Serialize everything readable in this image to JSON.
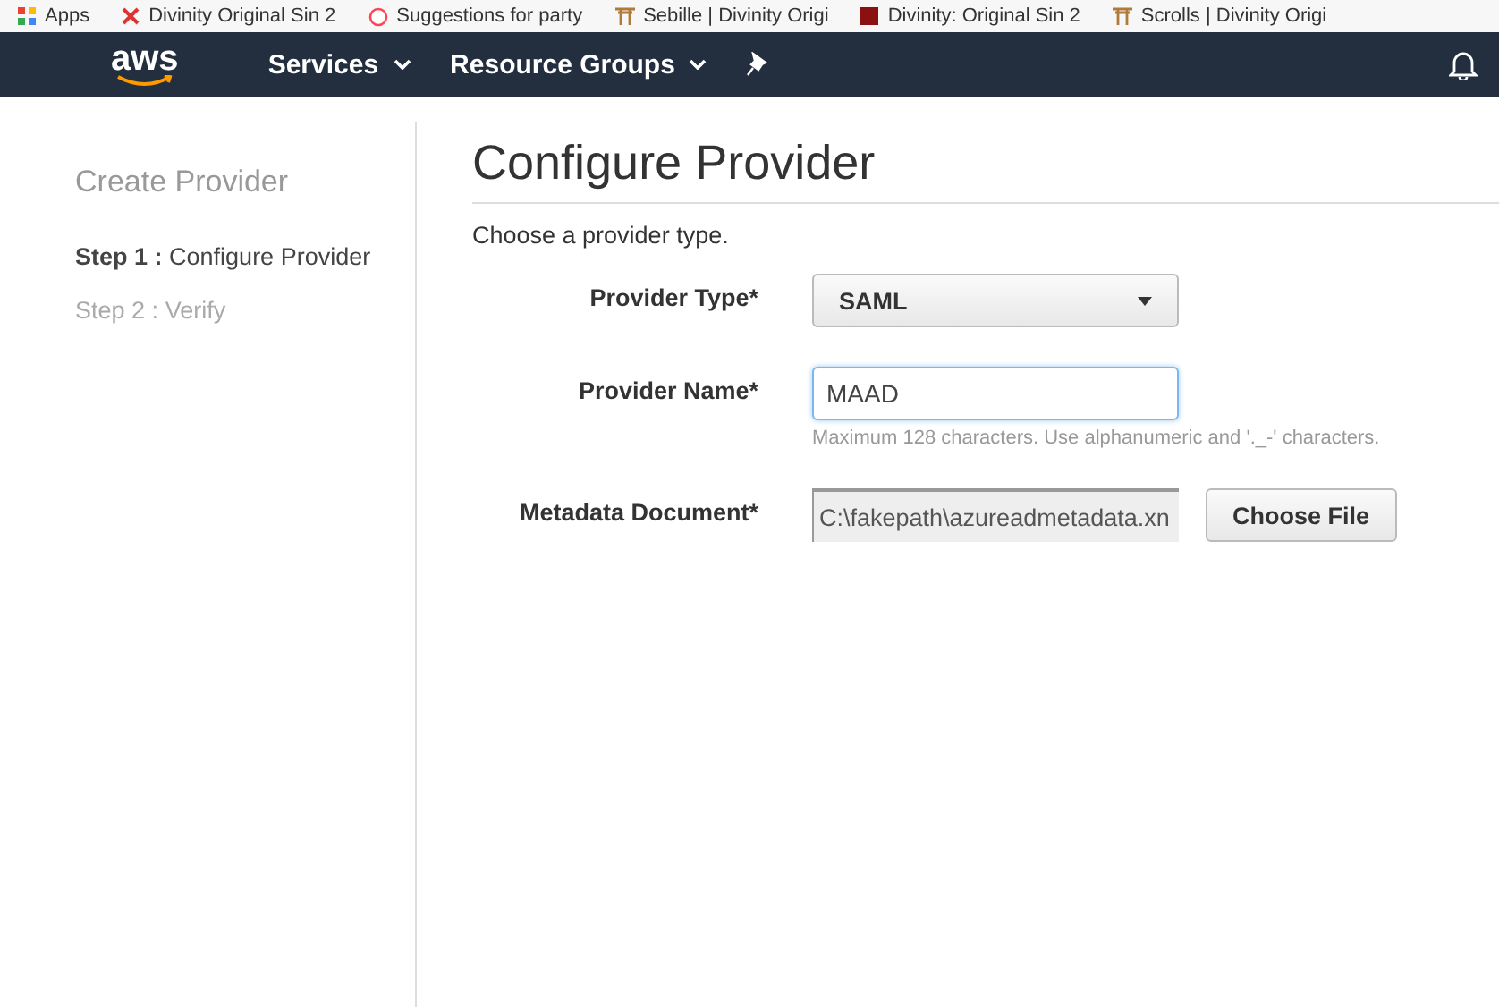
{
  "bookmarks": [
    {
      "label": "Apps",
      "kind": "apps"
    },
    {
      "label": "Divinity Original Sin 2",
      "kind": "cross"
    },
    {
      "label": "Suggestions for party",
      "kind": "face"
    },
    {
      "label": "Sebille | Divinity Origi",
      "kind": "torii"
    },
    {
      "label": "Divinity: Original Sin 2",
      "kind": "square"
    },
    {
      "label": "Scrolls | Divinity Origi",
      "kind": "torii"
    }
  ],
  "nav": {
    "logo": "aws",
    "menus": [
      {
        "label": "Services"
      },
      {
        "label": "Resource Groups"
      }
    ]
  },
  "sidebar": {
    "title": "Create Provider",
    "steps": [
      {
        "prefix": "Step 1 :",
        "label": "Configure Provider",
        "selected": true
      },
      {
        "prefix": "Step 2 :",
        "label": "Verify",
        "selected": false
      }
    ]
  },
  "main": {
    "title": "Configure Provider",
    "intro": "Choose a provider type.",
    "fields": [
      {
        "kind": "select",
        "label": "Provider Type*",
        "value": "SAML"
      },
      {
        "kind": "text",
        "label": "Provider Name*",
        "value": "MAAD",
        "hint": "Maximum 128 characters. Use alphanumeric and '._-' characters."
      },
      {
        "kind": "file",
        "label": "Metadata Document*",
        "value": "C:\\fakepath\\azureadmetadata.xn",
        "button": "Choose File"
      }
    ]
  }
}
